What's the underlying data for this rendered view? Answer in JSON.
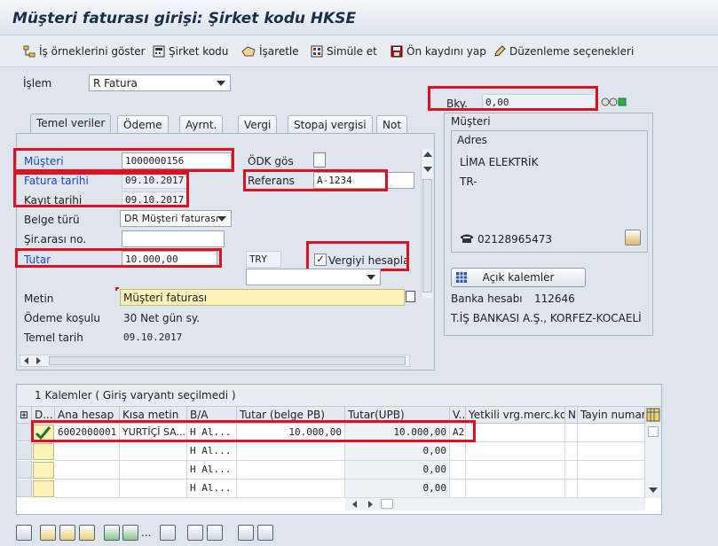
{
  "window": {
    "title": "Müşteri faturası girişi: Şirket kodu HKSE"
  },
  "toolbar": {
    "items": [
      {
        "label": "İş örneklerini göster",
        "icon": "tree-icon"
      },
      {
        "label": "Şirket kodu",
        "icon": "calculator-icon"
      },
      {
        "label": "İşaretle",
        "icon": "hand-icon"
      },
      {
        "label": "Simüle et",
        "icon": "simulate-icon"
      },
      {
        "label": "Ön kaydını yap",
        "icon": "save-icon"
      },
      {
        "label": "Düzenleme seçenekleri",
        "icon": "pencil-icon"
      }
    ]
  },
  "header": {
    "islem_label": "İşlem",
    "islem_value": "R Fatura",
    "bky_label": "Bky.",
    "bky_value": "0,00"
  },
  "tabs": [
    "Temel veriler",
    "Ödeme",
    "Ayrnt.",
    "Vergi",
    "Stopaj vergisi",
    "Not"
  ],
  "form": {
    "musteri_label": "Müşteri",
    "musteri_value": "1000000156",
    "odk_label": "ÖDK gös",
    "fatura_tarihi_label": "Fatura tarihi",
    "fatura_tarihi_value": "09.10.2017",
    "referans_label": "Referans",
    "referans_value": "A-1234",
    "kayit_tarihi_label": "Kayıt tarihi",
    "kayit_tarihi_value": "09.10.2017",
    "belge_turu_label": "Belge türü",
    "belge_turu_value": "DR Müşteri faturası",
    "sir_arasi_label": "Şir.arası no.",
    "sir_arasi_value": "",
    "tutar_label": "Tutar",
    "tutar_value": "10.000,00",
    "currency": "TRY",
    "vergiyi_hesapla_label": "Vergiyi hesapla",
    "metin_label": "Metin",
    "metin_value": "Müşteri faturası",
    "odeme_kosulu_label": "Ödeme koşulu",
    "odeme_kosulu_value": "30 Net gün sy.",
    "temel_tarih_label": "Temel tarih",
    "temel_tarih_value": "09.10.2017"
  },
  "customer_panel": {
    "title": "Müşteri",
    "address_title": "Adres",
    "name": "LİMA ELEKTRİK",
    "country": "TR-",
    "phone": "02128965473",
    "open_items_button": "Açık kalemler",
    "bank_account_label": "Banka hesabı",
    "bank_account_value": "112646",
    "bank_name": "T.İŞ BANKASI A.Ş., KORFEZ-KOCAELİ"
  },
  "items_table": {
    "title": "1 Kalemler ( Giriş varyantı seçilmedi )",
    "columns": [
      "D...",
      "Ana hesap",
      "Kısa metin",
      "B/A",
      "Tutar (belge PB)",
      "Tutar(UPB)",
      "V...",
      "Yetkili vrg.merc.kd",
      "N",
      "Tayin numarası"
    ],
    "rows": [
      {
        "ana_hesap": "6002000001",
        "kisa_metin": "YURTİÇİ SA...",
        "ba": "H Al...",
        "tutar_belge": "10.000,00",
        "tutar_upb": "10.000,00",
        "v": "A2"
      },
      {
        "ana_hesap": "",
        "kisa_metin": "",
        "ba": "H Al...",
        "tutar_belge": "",
        "tutar_upb": "0,00",
        "v": ""
      },
      {
        "ana_hesap": "",
        "kisa_metin": "",
        "ba": "H Al...",
        "tutar_belge": "",
        "tutar_upb": "0,00",
        "v": ""
      },
      {
        "ana_hesap": "",
        "kisa_metin": "",
        "ba": "H Al...",
        "tutar_belge": "",
        "tutar_upb": "0,00",
        "v": ""
      }
    ]
  }
}
